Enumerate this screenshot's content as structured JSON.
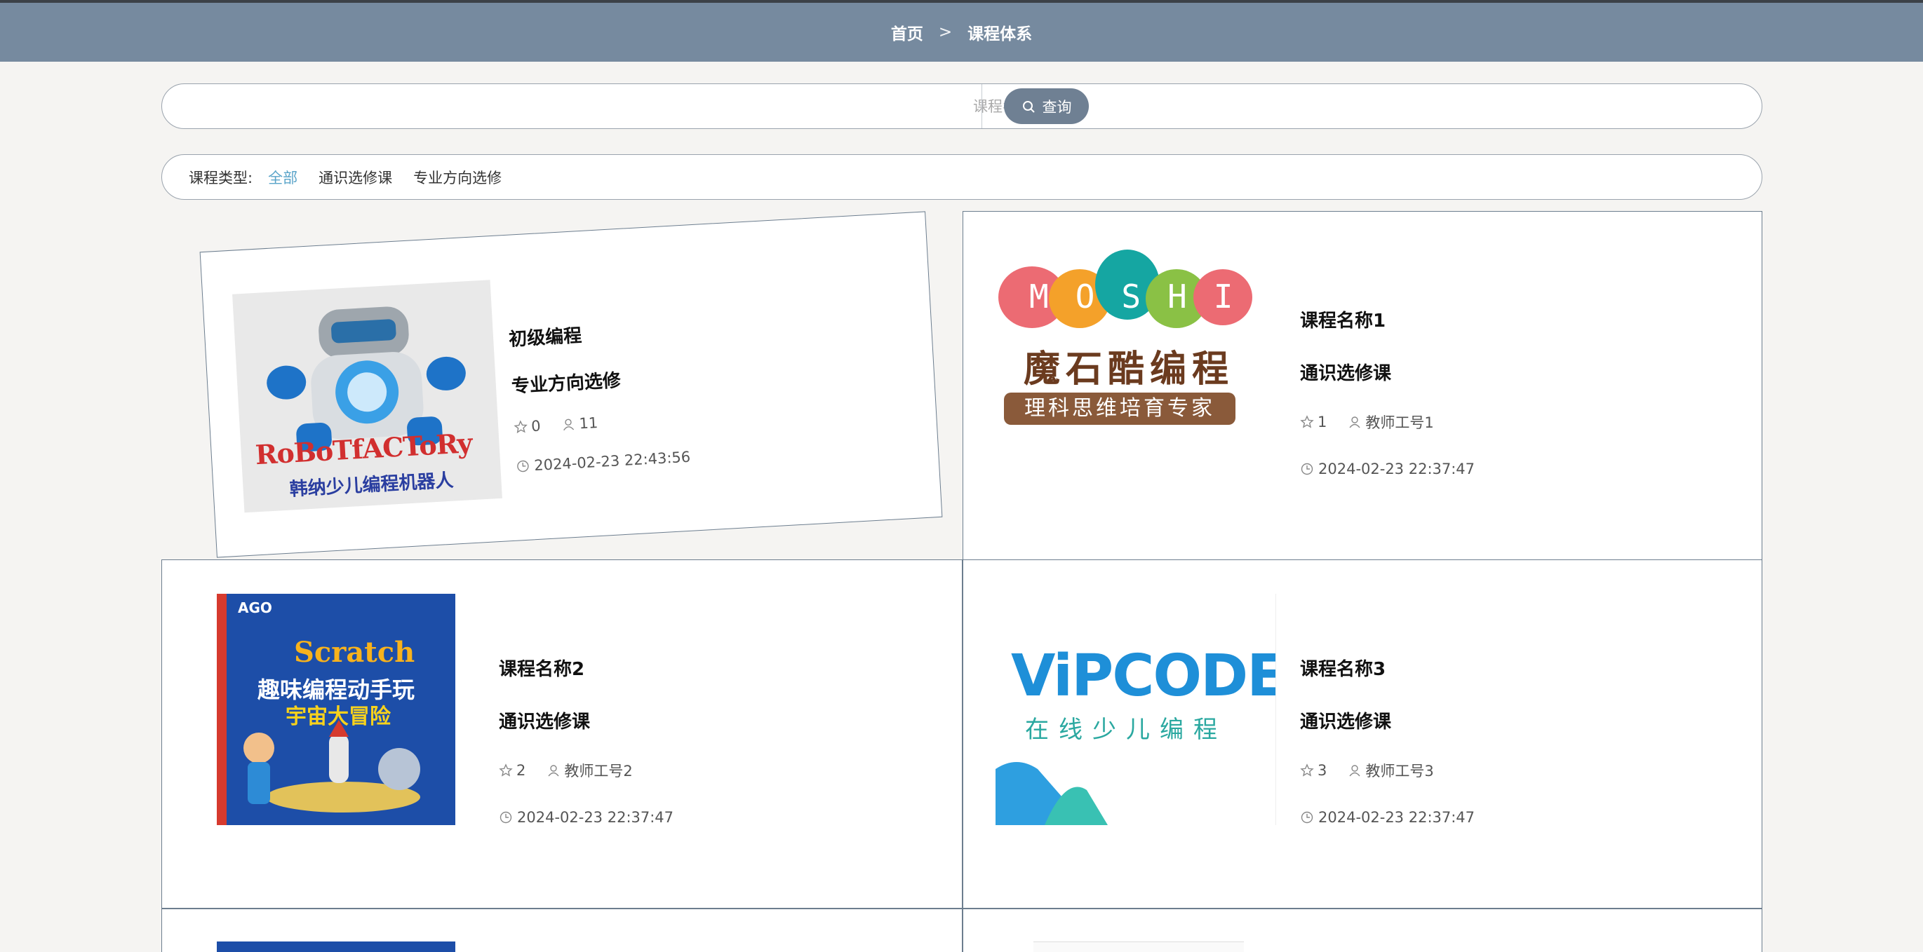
{
  "breadcrumb": {
    "home": "首页",
    "separator": ">",
    "current": "课程体系"
  },
  "search": {
    "placeholder": "课程名称",
    "value": "",
    "button_label": "查询"
  },
  "filter": {
    "label": "课程类型:",
    "options": [
      "全部",
      "通识选修课",
      "专业方向选修"
    ],
    "active": "全部"
  },
  "courses": [
    {
      "name": "初级编程",
      "type": "专业方向选修",
      "likes": "0",
      "teacher": "11",
      "date": "2024-02-23 22:43:56",
      "thumb_lines": [
        "RoBoTfACToRy",
        "韩纳少儿编程机器人"
      ]
    },
    {
      "name": "课程名称1",
      "type": "通识选修课",
      "likes": "1",
      "teacher": "教师工号1",
      "date": "2024-02-23 22:37:47",
      "thumb_lines": [
        "MOSHI",
        "魔石酷编程",
        "理科思维培育专家"
      ]
    },
    {
      "name": "课程名称2",
      "type": "通识选修课",
      "likes": "2",
      "teacher": "教师工号2",
      "date": "2024-02-23 22:37:47",
      "thumb_lines": [
        "AGO",
        "Scratch",
        "趣味编程动手玩",
        "宇宙大冒险"
      ]
    },
    {
      "name": "课程名称3",
      "type": "通识选修课",
      "likes": "3",
      "teacher": "教师工号3",
      "date": "2024-02-23 22:37:47",
      "thumb_lines": [
        "ViPCODE",
        "在线少儿编程"
      ]
    }
  ],
  "colors": {
    "header": "#768a9f",
    "accent": "#5aa4c9",
    "button": "#6f8093"
  }
}
